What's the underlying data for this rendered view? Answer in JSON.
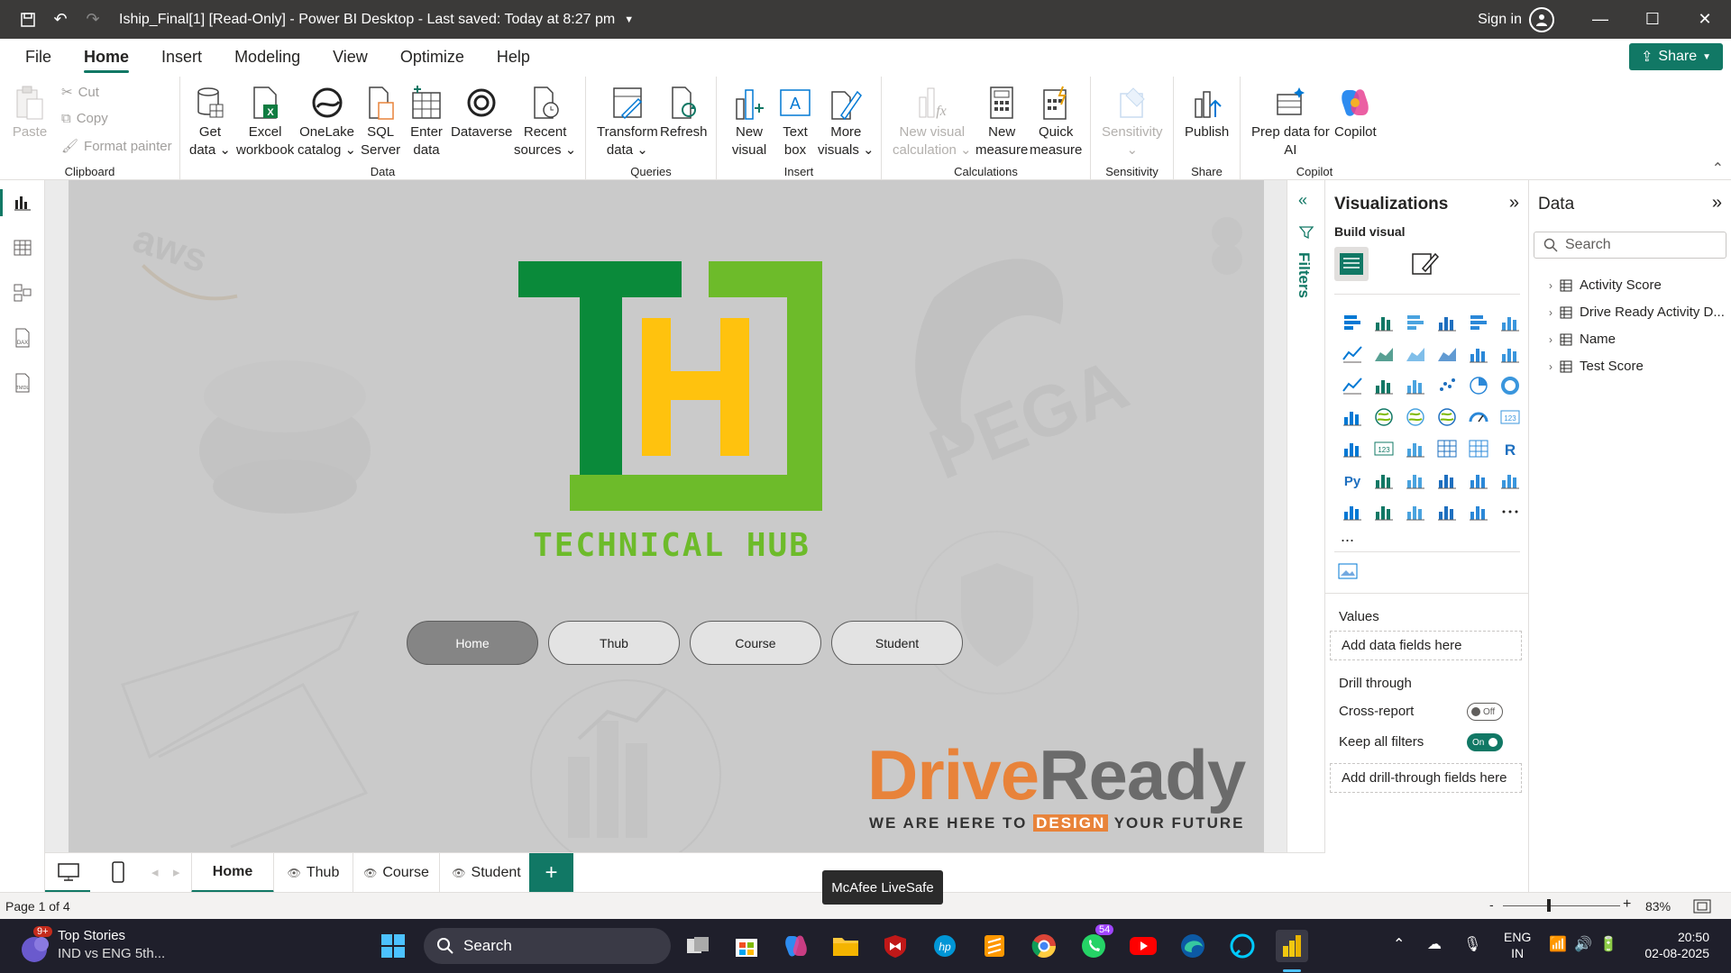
{
  "titlebar": {
    "title": "Iship_Final[1] [Read-Only] - Power BI Desktop - Last saved: Today at 8:27 pm",
    "sign_in": "Sign in"
  },
  "menu": {
    "items": [
      "File",
      "Home",
      "Insert",
      "Modeling",
      "View",
      "Optimize",
      "Help"
    ],
    "active": "Home",
    "share_label": "Share"
  },
  "ribbon": {
    "clipboard": {
      "paste": "Paste",
      "cut": "Cut",
      "copy": "Copy",
      "format_painter": "Format painter",
      "label": "Clipboard"
    },
    "data": {
      "get_data_1": "Get",
      "get_data_2": "data",
      "excel_1": "Excel",
      "excel_2": "workbook",
      "onelake_1": "OneLake",
      "onelake_2": "catalog",
      "sql_1": "SQL",
      "sql_2": "Server",
      "enter_1": "Enter",
      "enter_2": "data",
      "dataverse": "Dataverse",
      "recent_1": "Recent",
      "recent_2": "sources",
      "label": "Data"
    },
    "queries": {
      "transform_1": "Transform",
      "transform_2": "data",
      "refresh": "Refresh",
      "label": "Queries"
    },
    "insert": {
      "new_visual_1": "New",
      "new_visual_2": "visual",
      "text_box_1": "Text",
      "text_box_2": "box",
      "more_1": "More",
      "more_2": "visuals",
      "label": "Insert"
    },
    "calculations": {
      "new_visual_calc_1": "New visual",
      "new_visual_calc_2": "calculation",
      "new_measure_1": "New",
      "new_measure_2": "measure",
      "quick_measure_1": "Quick",
      "quick_measure_2": "measure",
      "label": "Calculations"
    },
    "sensitivity": {
      "btn": "Sensitivity",
      "label": "Sensitivity"
    },
    "share": {
      "publish": "Publish",
      "label": "Share"
    },
    "copilot": {
      "prep_1": "Prep data for",
      "prep_2": "AI",
      "copilot": "Copilot",
      "label": "Copilot"
    }
  },
  "report": {
    "logo_text": "TECHNICAL HUB",
    "logo_letters": "TH",
    "nav_buttons": [
      "Home",
      "Thub",
      "Course",
      "Student"
    ],
    "active_nav": "Home",
    "watermark_aws": "aws",
    "watermark_pega": "PEGA",
    "driveready_drive": "Drive",
    "driveready_ready": "Ready",
    "driveready_tagline_1": "WE ARE HERE TO",
    "driveready_tagline_design": "DESIGN",
    "driveready_tagline_2": "YOUR FUTURE"
  },
  "filters": {
    "label": "Filters"
  },
  "visualizations": {
    "title": "Visualizations",
    "build_visual": "Build visual",
    "values_label": "Values",
    "values_placeholder": "Add data fields here",
    "drill_through": "Drill through",
    "cross_report": "Cross-report",
    "cross_report_state": "Off",
    "keep_all_filters": "Keep all filters",
    "keep_all_filters_state": "On",
    "drill_placeholder": "Add drill-through fields here",
    "more": "..."
  },
  "data_pane": {
    "title": "Data",
    "search_placeholder": "Search",
    "tables": [
      "Activity Score",
      "Drive Ready Activity D...",
      "Name",
      "Test Score"
    ]
  },
  "pages": {
    "tabs": [
      "Home",
      "Thub",
      "Course",
      "Student"
    ],
    "active": "Home"
  },
  "status": {
    "page_info": "Page 1 of 4",
    "zoom": "83%",
    "tooltip": "McAfee LiveSafe"
  },
  "taskbar": {
    "news_title": "Top Stories",
    "news_sub": "IND vs ENG 5th...",
    "news_badge": "9+",
    "search": "Search",
    "whatsapp_badge": "54",
    "lang_1": "ENG",
    "lang_2": "IN",
    "time": "20:50",
    "date": "02-08-2025"
  },
  "colors": {
    "accent": "#117865",
    "logo_green_dark": "#0a8a3a",
    "logo_green_light": "#6dbb2a",
    "logo_yellow": "#ffc20e",
    "driveready_orange": "#e8833a"
  }
}
